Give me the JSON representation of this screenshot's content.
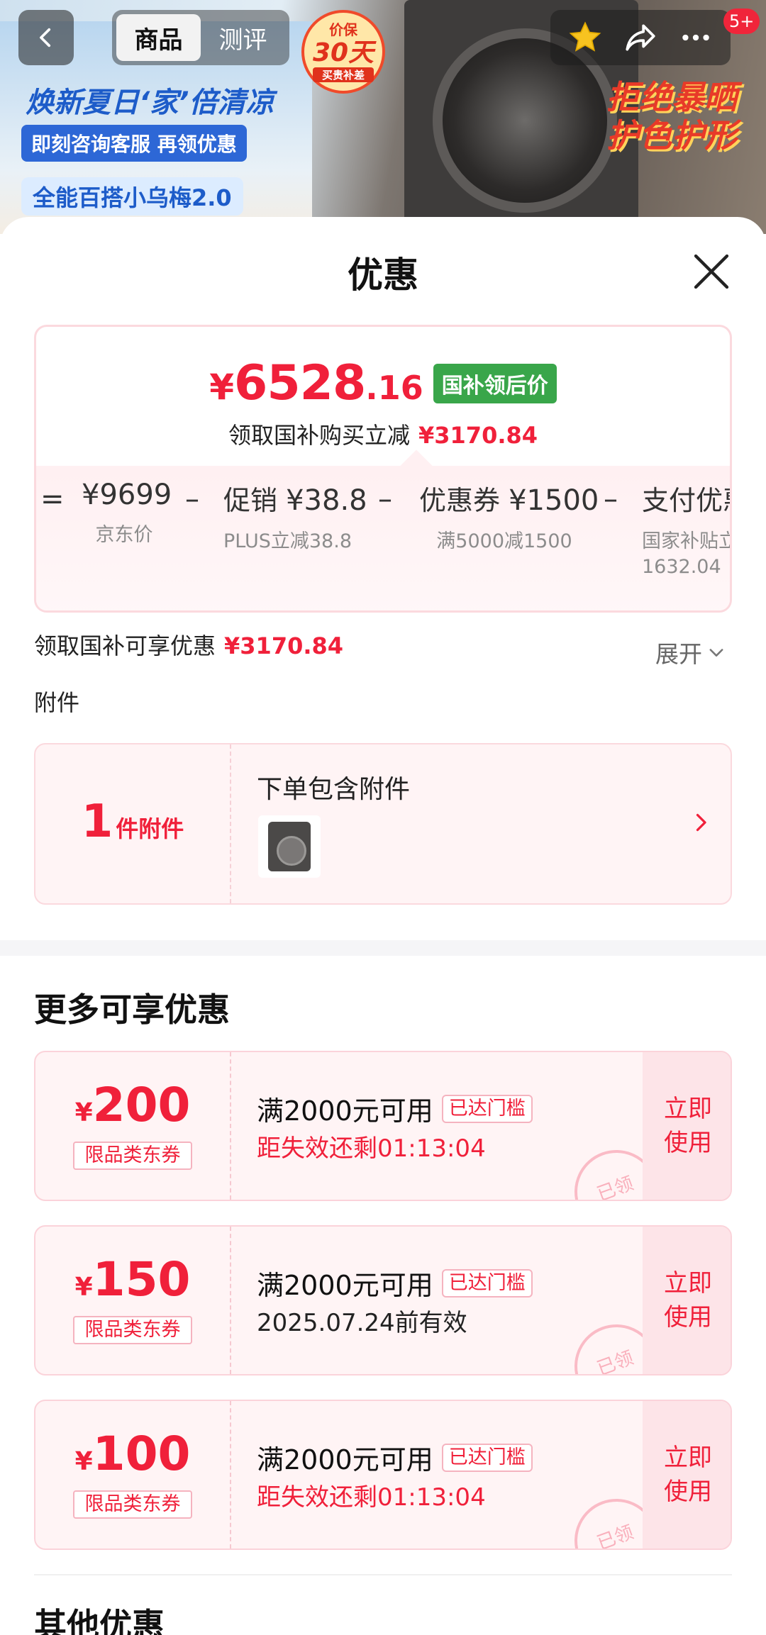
{
  "header": {
    "tabs": [
      "商品",
      "测评"
    ],
    "active_tab": "商品",
    "message_badge": "5+",
    "banner": {
      "promo_line1": "焕新夏日‘家’倍清凉",
      "promo_line2": "即刻咨询客服 再领优惠",
      "promo_line3": "全能百搭小乌梅2.0",
      "slogan": "拒绝暴晒 护色护形",
      "badge_top": "价保",
      "badge_mid": "30天",
      "badge_bottom": "买贵补差"
    }
  },
  "sheet": {
    "title": "优惠",
    "price": {
      "currency": "¥",
      "integer": "6528",
      "decimal": ".16",
      "tag": "国补领后价",
      "subtitle": "领取国补购买立减",
      "subtitle_amount": "¥3170.84"
    },
    "calc": {
      "jd_price": "¥9699",
      "jd_price_label": "京东价",
      "promo_label": "促销",
      "promo_amount": "¥38.8",
      "promo_sub": "PLUS立减38.8",
      "coupon_label": "优惠券",
      "coupon_amount": "¥1500",
      "coupon_sub": "满5000减1500",
      "pay_label": "支付优惠",
      "pay_sub1": "国家补贴立",
      "pay_sub2": "1632.04",
      "op_eq": "=",
      "op_minus": "–"
    },
    "enjoy": {
      "label": "领取国补可享优惠",
      "amount": "¥3170.84",
      "expand_label": "展开"
    },
    "attachment": {
      "section_title": "附件",
      "count": "1",
      "unit": "件附件",
      "text": "下单包含附件"
    },
    "more_title": "更多可享优惠",
    "coupons": [
      {
        "currency": "¥",
        "amount": "200",
        "type": "限品类东券",
        "condition": "满2000元可用",
        "reached": "已达门槛",
        "expiry": "距失效还剩01:13:04",
        "use": "立即使用",
        "stamp": "已领"
      },
      {
        "currency": "¥",
        "amount": "150",
        "type": "限品类东券",
        "condition": "满2000元可用",
        "reached": "已达门槛",
        "expiry": "2025.07.24前有效",
        "use": "立即使用",
        "stamp": "已领"
      },
      {
        "currency": "¥",
        "amount": "100",
        "type": "限品类东券",
        "condition": "满2000元可用",
        "reached": "已达门槛",
        "expiry": "距失效还剩01:13:04",
        "use": "立即使用",
        "stamp": "已领"
      }
    ],
    "other_title": "其他优惠"
  },
  "colors": {
    "accent_red": "#f0203a",
    "tag_green": "#39a64a",
    "coupon_bg": "#fff4f5"
  }
}
